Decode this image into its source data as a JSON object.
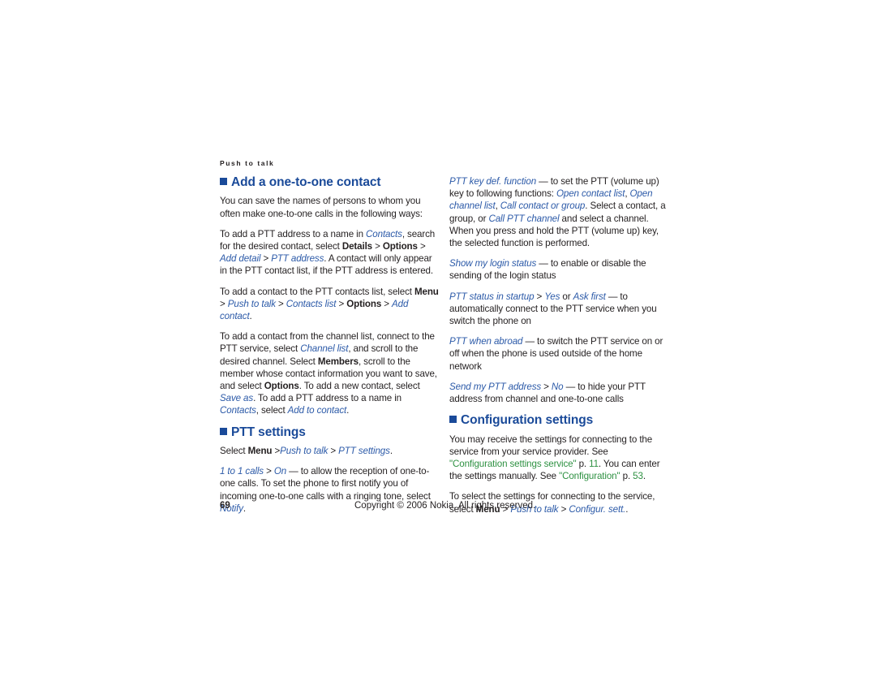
{
  "document": {
    "running_header": "Push to talk",
    "page_number": "69",
    "copyright": "Copyright © 2006 Nokia. All rights reserved.",
    "colors": {
      "heading_blue": "#1a4a99",
      "term_blue": "#2c5aa8",
      "link_green": "#2e9142",
      "body_text": "#231f20",
      "page_background": "#ffffff"
    }
  },
  "left_column": {
    "section1": {
      "heading": "Add a one-to-one contact",
      "p1": {
        "t1": "You can save the names of persons to whom you often make one-to-one calls in the following ways:"
      },
      "p2": {
        "t1": "To add a PTT address to a name in ",
        "i1": "Contacts",
        "t2": ", search for the desired contact, select ",
        "b1": "Details",
        "s1": " > ",
        "b2": "Options",
        "s2": " > ",
        "i2": "Add detail",
        "s3": " > ",
        "i3": "PTT address",
        "t3": ". A contact will only appear in the PTT contact list, if the PTT address is entered."
      },
      "p3": {
        "t1": "To add a contact to the PTT contacts list, select ",
        "b1": "Menu",
        "s1": " > ",
        "i1": "Push to talk",
        "s2": " > ",
        "i2": "Contacts list",
        "s3": " > ",
        "b2": "Options",
        "s4": " > ",
        "i3": "Add contact",
        "t2": "."
      },
      "p4": {
        "t1": "To add a contact from the channel list, connect to the PTT service, select ",
        "i1": "Channel list",
        "t2": ", and scroll to the desired channel. Select ",
        "b1": "Members",
        "t3": ", scroll to the member whose contact information you want to save, and select ",
        "b2": "Options",
        "t4": ". To add a new contact, select ",
        "i2": "Save as",
        "t5": ". To add a PTT address to a name in ",
        "i3": "Contacts",
        "t6": ", select ",
        "i4": "Add to contact",
        "t7": "."
      }
    },
    "section2": {
      "heading": "PTT settings",
      "p1": {
        "t1": "Select ",
        "b1": "Menu",
        "s1": " >",
        "i1": "Push to talk",
        "s2": " > ",
        "i2": "PTT settings",
        "t2": "."
      },
      "p2": {
        "i1": "1 to 1 calls",
        "s1": " > ",
        "i2": "On",
        "t1": " — to allow the reception of one-to-one calls. To set the phone to first notify you of incoming one-to-one calls with a ringing tone, select ",
        "i3": "Notify",
        "t2": "."
      }
    }
  },
  "right_column": {
    "settings_list": {
      "p1": {
        "i1": "PTT key def. function",
        "t1": " — to set the PTT (volume up) key to following functions: ",
        "i2": "Open contact list",
        "t2": ", ",
        "i3": "Open channel list",
        "t3": ", ",
        "i4": "Call contact or group",
        "t4": ". Select a contact, a group, or ",
        "i5": "Call PTT channel",
        "t5": " and select a channel. When you press and hold the PTT (volume up) key, the selected function is performed."
      },
      "p2": {
        "i1": "Show my login status",
        "t1": " — to enable or disable the sending of the login status"
      },
      "p3": {
        "i1": "PTT status in startup",
        "s1": " > ",
        "i2": "Yes",
        "t1": " or ",
        "i3": "Ask first",
        "t2": " — to automatically connect to the PTT service when you switch the phone on"
      },
      "p4": {
        "i1": "PTT when abroad",
        "t1": " — to switch the PTT service on or off when the phone is used outside of the home network"
      },
      "p5": {
        "i1": "Send my PTT address",
        "s1": " > ",
        "i2": "No",
        "t1": " — to hide your PTT address from channel and one-to-one calls"
      }
    },
    "section3": {
      "heading": "Configuration settings",
      "p1": {
        "t1": "You may receive the settings for connecting to the service from your service provider. See ",
        "g1": "\"Configuration settings service\"",
        "t2": " p. ",
        "g2": "11",
        "t3": ". You can enter the settings manually. See ",
        "g3": "\"Configuration\"",
        "t4": " p. ",
        "g4": "53",
        "t5": "."
      },
      "p2": {
        "t1": "To select the settings for connecting to the service, select ",
        "b1": "Menu",
        "s1": " > ",
        "i1": "Push to talk",
        "s2": " > ",
        "i2": "Configur. sett.",
        "t2": "."
      }
    }
  }
}
